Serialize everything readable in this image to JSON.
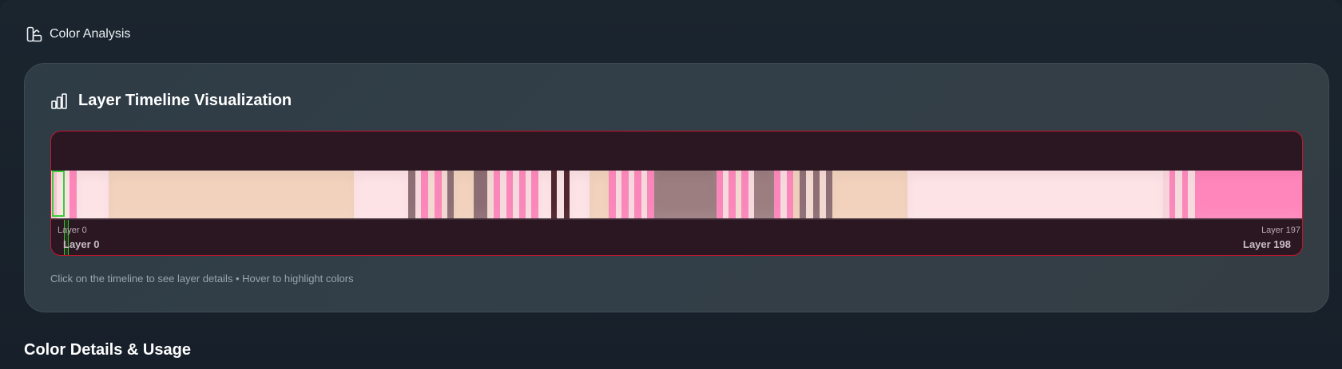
{
  "section": {
    "icon": "palette-icon",
    "label": "Color Analysis"
  },
  "card": {
    "icon": "bar-chart-icon",
    "title": "Layer Timeline Visualization",
    "hint": "Click on the timeline to see layer details • Hover to highlight colors"
  },
  "timeline": {
    "start_tick": "Layer 0",
    "end_tick": "Layer 197",
    "range_start": "Layer 0",
    "range_end": "Layer 198",
    "border_color": "#c2162c",
    "selection_color": "#3bcc3b",
    "selected_layer": 0,
    "segments": [
      {
        "color": "#f9c6d6",
        "weight": 7
      },
      {
        "color": "#fde4e6",
        "weight": 15
      },
      {
        "color": "#ff86bb",
        "weight": 8
      },
      {
        "color": "#fde3e6",
        "weight": 38
      },
      {
        "color": "#f2d2bd",
        "weight": 288
      },
      {
        "color": "#fde3e6",
        "weight": 64
      },
      {
        "color": "#8c6c72",
        "weight": 8
      },
      {
        "color": "#fbdde0",
        "weight": 7
      },
      {
        "color": "#ff86bb",
        "weight": 8
      },
      {
        "color": "#f6dcd4",
        "weight": 8
      },
      {
        "color": "#ff86bb",
        "weight": 8
      },
      {
        "color": "#f6dcd4",
        "weight": 7
      },
      {
        "color": "#8c6c72",
        "weight": 7
      },
      {
        "color": "#f2d2bd",
        "weight": 24
      },
      {
        "color": "#8c6c72",
        "weight": 16
      },
      {
        "color": "#f6dcd4",
        "weight": 7
      },
      {
        "color": "#ff86bb",
        "weight": 8
      },
      {
        "color": "#fbdde0",
        "weight": 7
      },
      {
        "color": "#ff86bb",
        "weight": 8
      },
      {
        "color": "#fbdde0",
        "weight": 7
      },
      {
        "color": "#ff86bb",
        "weight": 8
      },
      {
        "color": "#fbdde0",
        "weight": 7
      },
      {
        "color": "#ff86bb",
        "weight": 8
      },
      {
        "color": "#fde3e6",
        "weight": 15
      },
      {
        "color": "#4a1f26",
        "weight": 7
      },
      {
        "color": "#fde3e6",
        "weight": 8
      },
      {
        "color": "#4a1f26",
        "weight": 7
      },
      {
        "color": "#fde3e6",
        "weight": 23
      },
      {
        "color": "#f2d2bd",
        "weight": 23
      },
      {
        "color": "#ff86bb",
        "weight": 8
      },
      {
        "color": "#fbdde0",
        "weight": 7
      },
      {
        "color": "#ff86bb",
        "weight": 8
      },
      {
        "color": "#fbdde0",
        "weight": 7
      },
      {
        "color": "#ff86bb",
        "weight": 8
      },
      {
        "color": "#fbdde0",
        "weight": 7
      },
      {
        "color": "#ff86bb",
        "weight": 8
      },
      {
        "color": "#9c7d80",
        "weight": 73
      },
      {
        "color": "#ff86bb",
        "weight": 8
      },
      {
        "color": "#fbdde0",
        "weight": 7
      },
      {
        "color": "#ff86bb",
        "weight": 8
      },
      {
        "color": "#f6dcd4",
        "weight": 7
      },
      {
        "color": "#ff86bb",
        "weight": 8
      },
      {
        "color": "#fbdde0",
        "weight": 7
      },
      {
        "color": "#9c7d80",
        "weight": 23
      },
      {
        "color": "#ff86bb",
        "weight": 8
      },
      {
        "color": "#fbdde0",
        "weight": 7
      },
      {
        "color": "#ff86bb",
        "weight": 8
      },
      {
        "color": "#f2d2bd",
        "weight": 7
      },
      {
        "color": "#8c6c72",
        "weight": 8
      },
      {
        "color": "#f6dcd4",
        "weight": 8
      },
      {
        "color": "#8c6c72",
        "weight": 8
      },
      {
        "color": "#f6dcd4",
        "weight": 7
      },
      {
        "color": "#8c6c72",
        "weight": 8
      },
      {
        "color": "#f2d2bd",
        "weight": 88
      },
      {
        "color": "#fde3e6",
        "weight": 301
      },
      {
        "color": "#fbd6de",
        "weight": 7
      },
      {
        "color": "#ff86bb",
        "weight": 7
      },
      {
        "color": "#fbdde0",
        "weight": 8
      },
      {
        "color": "#ff86bb",
        "weight": 7
      },
      {
        "color": "#fbdde0",
        "weight": 8
      },
      {
        "color": "#ff86bb",
        "weight": 126
      }
    ]
  }
}
